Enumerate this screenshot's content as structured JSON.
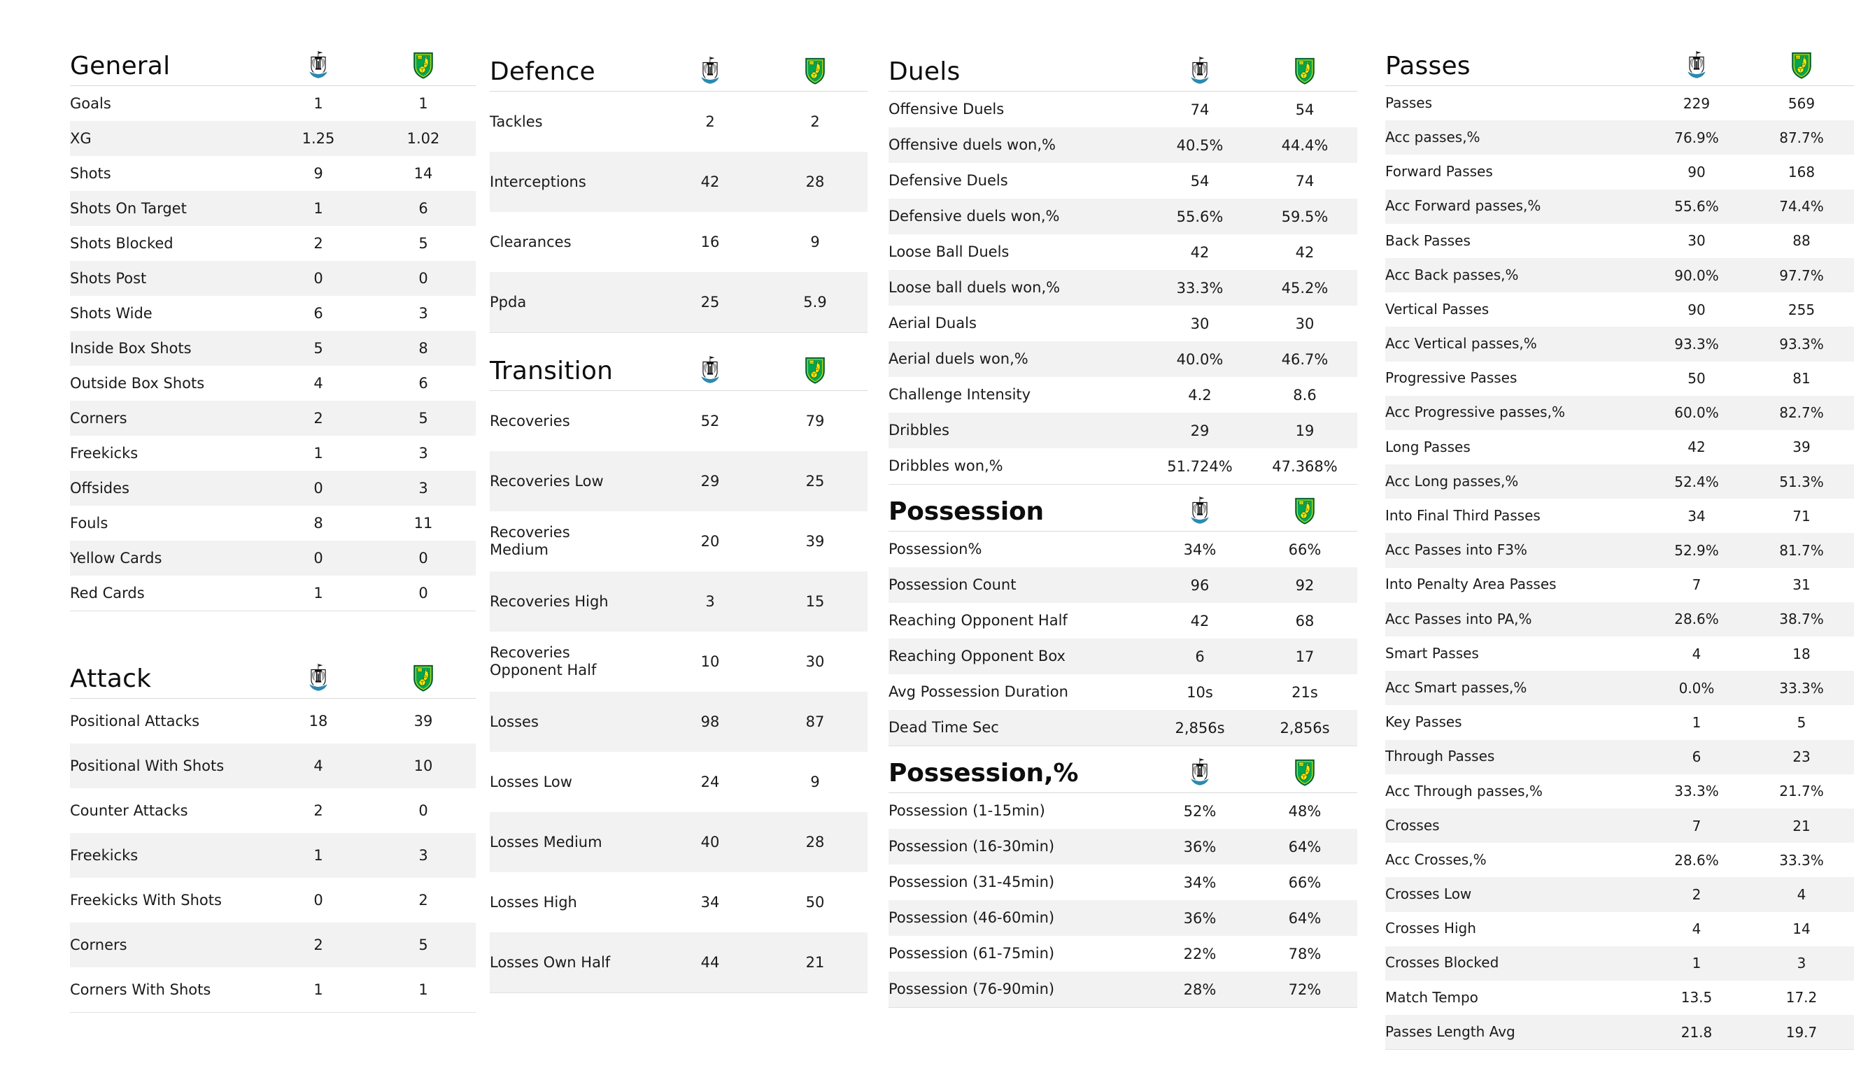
{
  "teams": {
    "home": {
      "name": "Newcastle United",
      "crest": "newcastle-crest"
    },
    "away": {
      "name": "Norwich City",
      "crest": "norwich-crest"
    }
  },
  "sections": [
    {
      "id": "general",
      "title": "General",
      "bold": false,
      "column": 1,
      "rows": [
        {
          "label": "Goals",
          "home": "1",
          "away": "1"
        },
        {
          "label": "XG",
          "home": "1.25",
          "away": "1.02"
        },
        {
          "label": "Shots",
          "home": "9",
          "away": "14"
        },
        {
          "label": "Shots On Target",
          "home": "1",
          "away": "6"
        },
        {
          "label": "Shots Blocked",
          "home": "2",
          "away": "5"
        },
        {
          "label": "Shots Post",
          "home": "0",
          "away": "0"
        },
        {
          "label": "Shots Wide",
          "home": "6",
          "away": "3"
        },
        {
          "label": "Inside Box Shots",
          "home": "5",
          "away": "8"
        },
        {
          "label": "Outside Box Shots",
          "home": "4",
          "away": "6"
        },
        {
          "label": "Corners",
          "home": "2",
          "away": "5"
        },
        {
          "label": "Freekicks",
          "home": "1",
          "away": "3"
        },
        {
          "label": "Offsides",
          "home": "0",
          "away": "3"
        },
        {
          "label": "Fouls",
          "home": "8",
          "away": "11"
        },
        {
          "label": "Yellow Cards",
          "home": "0",
          "away": "0"
        },
        {
          "label": "Red Cards",
          "home": "1",
          "away": "0"
        }
      ]
    },
    {
      "id": "attack",
      "title": "Attack",
      "bold": false,
      "column": 1,
      "rows": [
        {
          "label": "Positional Attacks",
          "home": "18",
          "away": "39"
        },
        {
          "label": "Positional With Shots",
          "home": "4",
          "away": "10"
        },
        {
          "label": "Counter Attacks",
          "home": "2",
          "away": "0"
        },
        {
          "label": "Freekicks",
          "home": "1",
          "away": "3"
        },
        {
          "label": "Freekicks With Shots",
          "home": "0",
          "away": "2"
        },
        {
          "label": "Corners",
          "home": "2",
          "away": "5"
        },
        {
          "label": "Corners With Shots",
          "home": "1",
          "away": "1"
        }
      ]
    },
    {
      "id": "defence",
      "title": "Defence",
      "bold": false,
      "column": 2,
      "rows": [
        {
          "label": "Tackles",
          "home": "2",
          "away": "2"
        },
        {
          "label": "Interceptions",
          "home": "42",
          "away": "28"
        },
        {
          "label": "Clearances",
          "home": "16",
          "away": "9"
        },
        {
          "label": "Ppda",
          "home": "25",
          "away": "5.9"
        }
      ]
    },
    {
      "id": "transition",
      "title": "Transition",
      "bold": false,
      "column": 2,
      "rows": [
        {
          "label": "Recoveries",
          "home": "52",
          "away": "79"
        },
        {
          "label": "Recoveries Low",
          "home": "29",
          "away": "25"
        },
        {
          "label": "Recoveries Medium",
          "home": "20",
          "away": "39"
        },
        {
          "label": "Recoveries High",
          "home": "3",
          "away": "15"
        },
        {
          "label": "Recoveries Opponent Half",
          "home": "10",
          "away": "30"
        },
        {
          "label": "Losses",
          "home": "98",
          "away": "87"
        },
        {
          "label": "Losses Low",
          "home": "24",
          "away": "9"
        },
        {
          "label": "Losses Medium",
          "home": "40",
          "away": "28"
        },
        {
          "label": "Losses High",
          "home": "34",
          "away": "50"
        },
        {
          "label": "Losses Own Half",
          "home": "44",
          "away": "21"
        }
      ]
    },
    {
      "id": "duels",
      "title": "Duels",
      "bold": false,
      "column": 3,
      "rows": [
        {
          "label": "Offensive Duels",
          "home": "74",
          "away": "54"
        },
        {
          "label": "Offensive duels won,%",
          "home": "40.5%",
          "away": "44.4%"
        },
        {
          "label": "Defensive Duels",
          "home": "54",
          "away": "74"
        },
        {
          "label": "Defensive duels won,%",
          "home": "55.6%",
          "away": "59.5%"
        },
        {
          "label": "Loose Ball Duels",
          "home": "42",
          "away": "42"
        },
        {
          "label": "Loose ball duels won,%",
          "home": "33.3%",
          "away": "45.2%"
        },
        {
          "label": "Aerial Duals",
          "home": "30",
          "away": "30"
        },
        {
          "label": "Aerial duels won,%",
          "home": "40.0%",
          "away": "46.7%"
        },
        {
          "label": "Challenge Intensity",
          "home": "4.2",
          "away": "8.6"
        },
        {
          "label": "Dribbles",
          "home": "29",
          "away": "19"
        },
        {
          "label": "Dribbles won,%",
          "home": "51.724%",
          "away": "47.368%"
        }
      ]
    },
    {
      "id": "possession",
      "title": "Possession",
      "bold": true,
      "column": 3,
      "rows": [
        {
          "label": "Possession%",
          "home": "34%",
          "away": "66%"
        },
        {
          "label": "Possession Count",
          "home": "96",
          "away": "92"
        },
        {
          "label": "Reaching Opponent Half",
          "home": "42",
          "away": "68"
        },
        {
          "label": "Reaching Opponent Box",
          "home": "6",
          "away": "17"
        },
        {
          "label": "Avg Possession Duration",
          "home": "10s",
          "away": "21s"
        },
        {
          "label": "Dead Time Sec",
          "home": "2,856s",
          "away": "2,856s"
        }
      ]
    },
    {
      "id": "possession-pct",
      "title": "Possession,%",
      "bold": true,
      "column": 3,
      "rows": [
        {
          "label": "Possession (1-15min)",
          "home": "52%",
          "away": "48%"
        },
        {
          "label": "Possession (16-30min)",
          "home": "36%",
          "away": "64%"
        },
        {
          "label": "Possession (31-45min)",
          "home": "34%",
          "away": "66%"
        },
        {
          "label": "Possession (46-60min)",
          "home": "36%",
          "away": "64%"
        },
        {
          "label": "Possession (61-75min)",
          "home": "22%",
          "away": "78%"
        },
        {
          "label": "Possession (76-90min)",
          "home": "28%",
          "away": "72%"
        }
      ]
    },
    {
      "id": "passes",
      "title": "Passes",
      "bold": false,
      "column": 4,
      "rows": [
        {
          "label": "Passes",
          "home": "229",
          "away": "569"
        },
        {
          "label": "Acc passes,%",
          "home": "76.9%",
          "away": "87.7%"
        },
        {
          "label": "Forward Passes",
          "home": "90",
          "away": "168"
        },
        {
          "label": "Acc Forward passes,%",
          "home": "55.6%",
          "away": "74.4%"
        },
        {
          "label": "Back Passes",
          "home": "30",
          "away": "88"
        },
        {
          "label": "Acc Back passes,%",
          "home": "90.0%",
          "away": "97.7%"
        },
        {
          "label": "Vertical Passes",
          "home": "90",
          "away": "255"
        },
        {
          "label": "Acc Vertical passes,%",
          "home": "93.3%",
          "away": "93.3%"
        },
        {
          "label": "Progressive Passes",
          "home": "50",
          "away": "81"
        },
        {
          "label": "Acc Progressive passes,%",
          "home": "60.0%",
          "away": "82.7%"
        },
        {
          "label": "Long Passes",
          "home": "42",
          "away": "39"
        },
        {
          "label": "Acc Long passes,%",
          "home": "52.4%",
          "away": "51.3%"
        },
        {
          "label": "Into Final Third Passes",
          "home": "34",
          "away": "71"
        },
        {
          "label": "Acc Passes into F3%",
          "home": "52.9%",
          "away": "81.7%"
        },
        {
          "label": "Into Penalty Area Passes",
          "home": "7",
          "away": "31"
        },
        {
          "label": "Acc Passes into PA,%",
          "home": "28.6%",
          "away": "38.7%"
        },
        {
          "label": "Smart Passes",
          "home": "4",
          "away": "18"
        },
        {
          "label": "Acc Smart passes,%",
          "home": "0.0%",
          "away": "33.3%"
        },
        {
          "label": "Key Passes",
          "home": "1",
          "away": "5"
        },
        {
          "label": "Through Passes",
          "home": "6",
          "away": "23"
        },
        {
          "label": "Acc Through passes,%",
          "home": "33.3%",
          "away": "21.7%"
        },
        {
          "label": "Crosses",
          "home": "7",
          "away": "21"
        },
        {
          "label": "Acc Crosses,%",
          "home": "28.6%",
          "away": "33.3%"
        },
        {
          "label": "Crosses Low",
          "home": "2",
          "away": "4"
        },
        {
          "label": "Crosses High",
          "home": "4",
          "away": "14"
        },
        {
          "label": "Crosses Blocked",
          "home": "1",
          "away": "3"
        },
        {
          "label": "Match Tempo",
          "home": "13.5",
          "away": "17.2"
        },
        {
          "label": "Passes Length Avg",
          "home": "21.8",
          "away": "19.7"
        }
      ]
    }
  ],
  "colors": {
    "row_alt_background": "#f2f2f2",
    "rule": "#d9d9d9",
    "text": "#1a1a1a",
    "newcastle_accent": "#2b8ab0",
    "norwich_green": "#00a650",
    "norwich_yellow": "#fff200"
  }
}
